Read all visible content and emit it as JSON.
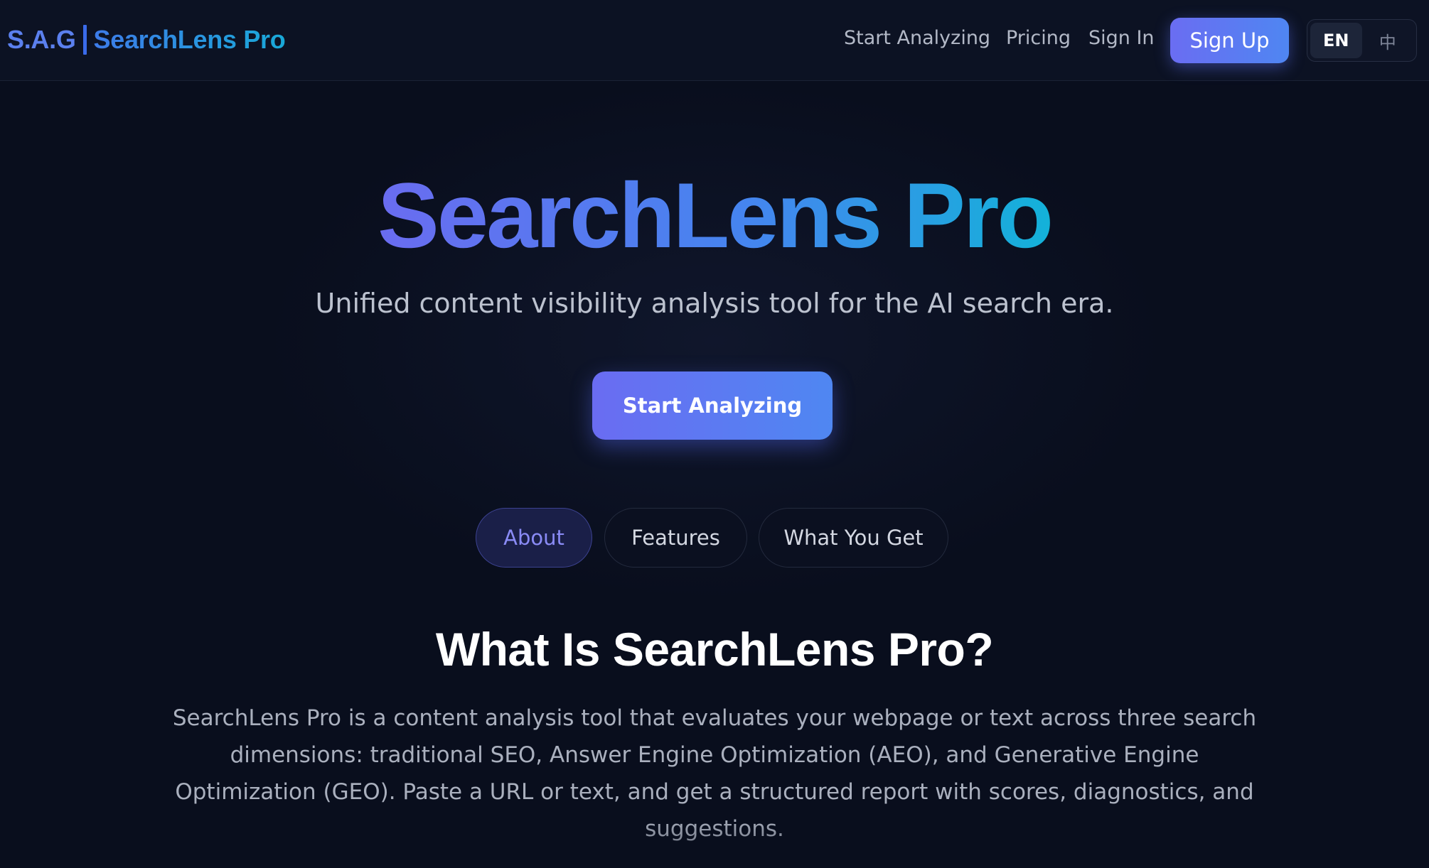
{
  "brand": {
    "prefix": "S.A.G",
    "name": "SearchLens Pro"
  },
  "nav": {
    "links": [
      {
        "label": "Start Analyzing"
      },
      {
        "label": "Pricing"
      },
      {
        "label": "Sign In"
      }
    ],
    "signup_label": "Sign Up",
    "languages": [
      {
        "label": "EN",
        "active": true
      },
      {
        "label": "中",
        "active": false
      }
    ]
  },
  "hero": {
    "title": "SearchLens Pro",
    "subtitle": "Unified content visibility analysis tool for the AI search era.",
    "cta_label": "Start Analyzing"
  },
  "tabs": [
    {
      "label": "About",
      "active": true
    },
    {
      "label": "Features",
      "active": false
    },
    {
      "label": "What You Get",
      "active": false
    }
  ],
  "section": {
    "title": "What Is SearchLens Pro?",
    "body": "SearchLens Pro is a content analysis tool that evaluates your webpage or text across three search dimensions: traditional SEO, Answer Engine Optimization (AEO), and Generative Engine Optimization (GEO). Paste a URL or text, and get a structured report with scores, diagnostics, and suggestions."
  },
  "colors": {
    "background": "#090e1d",
    "accent_start": "#6a6cf0",
    "accent_end": "#13b2d9",
    "active_tab_bg": "#1a1f48",
    "active_tab_text": "#8a8bf6"
  }
}
